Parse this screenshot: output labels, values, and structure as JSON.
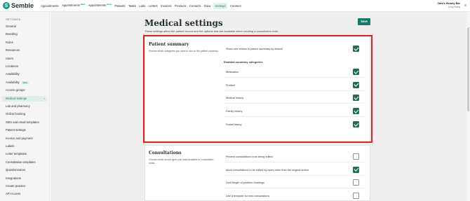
{
  "app": {
    "logo_text": "Semble"
  },
  "nav": {
    "items": [
      {
        "label": "Appointments",
        "badge": ""
      },
      {
        "label": "Appointments",
        "badge": "Beta"
      },
      {
        "label": "Appointments",
        "badge": "Beta"
      },
      {
        "label": "Patients",
        "badge": ""
      },
      {
        "label": "Tasks",
        "badge": ""
      },
      {
        "label": "Labs",
        "badge": ""
      },
      {
        "label": "Letters",
        "badge": ""
      },
      {
        "label": "Invoices",
        "badge": ""
      },
      {
        "label": "Products",
        "badge": ""
      },
      {
        "label": "Contacts",
        "badge": ""
      },
      {
        "label": "Data",
        "badge": ""
      },
      {
        "label": "Settings",
        "badge": ""
      },
      {
        "label": "Connect",
        "badge": ""
      }
    ],
    "active": "Settings"
  },
  "user": {
    "name": "Cara's Beauty Bar",
    "role": "Unity Swing"
  },
  "sidebar": {
    "title": "SETTINGS",
    "items": [
      {
        "label": "General"
      },
      {
        "label": "Branding"
      },
      {
        "label": "Roles"
      },
      {
        "label": "Resources"
      },
      {
        "label": "Users"
      },
      {
        "label": "Locations"
      },
      {
        "label": "Availability"
      },
      {
        "label": "Availability",
        "badge": "beta"
      },
      {
        "label": "Access groups"
      },
      {
        "label": "Medical settings",
        "active": true
      },
      {
        "label": "Lab and pharmacy"
      },
      {
        "label": "Online booking"
      },
      {
        "label": "SMS and email templates"
      },
      {
        "label": "Patient settings"
      },
      {
        "label": "Invoice and payment"
      },
      {
        "label": "Labels"
      },
      {
        "label": "Letter templates"
      },
      {
        "label": "Consultation templates"
      },
      {
        "label": "Questionnaires"
      },
      {
        "label": "Integrations"
      },
      {
        "label": "Create practice"
      },
      {
        "label": "API Access"
      }
    ]
  },
  "page": {
    "title": "Medical settings",
    "description": "These settings affect the patient record and the options that are available when creating a consultation note.",
    "save_label": "Save"
  },
  "patient_summary": {
    "title": "Patient summary",
    "description": "Choose which categories you want to see on the patient summary.",
    "show_new_entries": {
      "label": "Show new entries in patient summary by default",
      "checked": true
    },
    "categories_heading": "Enabled summary categories",
    "categories": [
      {
        "label": "Medication",
        "checked": true
      },
      {
        "label": "Product",
        "checked": true
      },
      {
        "label": "Medical history",
        "checked": true
      },
      {
        "label": "Family history",
        "checked": true
      },
      {
        "label": "Social history",
        "checked": true
      }
    ]
  },
  "consultations": {
    "title": "Consultations",
    "description": "Choose which record types you want available in consultation notes.",
    "options": [
      {
        "label": "Prevent consultations from being edited",
        "checked": false
      },
      {
        "label": "Allow consultations to be edited by users other than the original author",
        "checked": true
      },
      {
        "label": "Limit length of problem headings",
        "checked": false
      },
      {
        "label": "Use a template for new consultations",
        "checked": false
      }
    ]
  },
  "colors": {
    "accent": "#157a66",
    "checkbox_on": "#1f6f57",
    "highlight": "#e11f1f"
  }
}
